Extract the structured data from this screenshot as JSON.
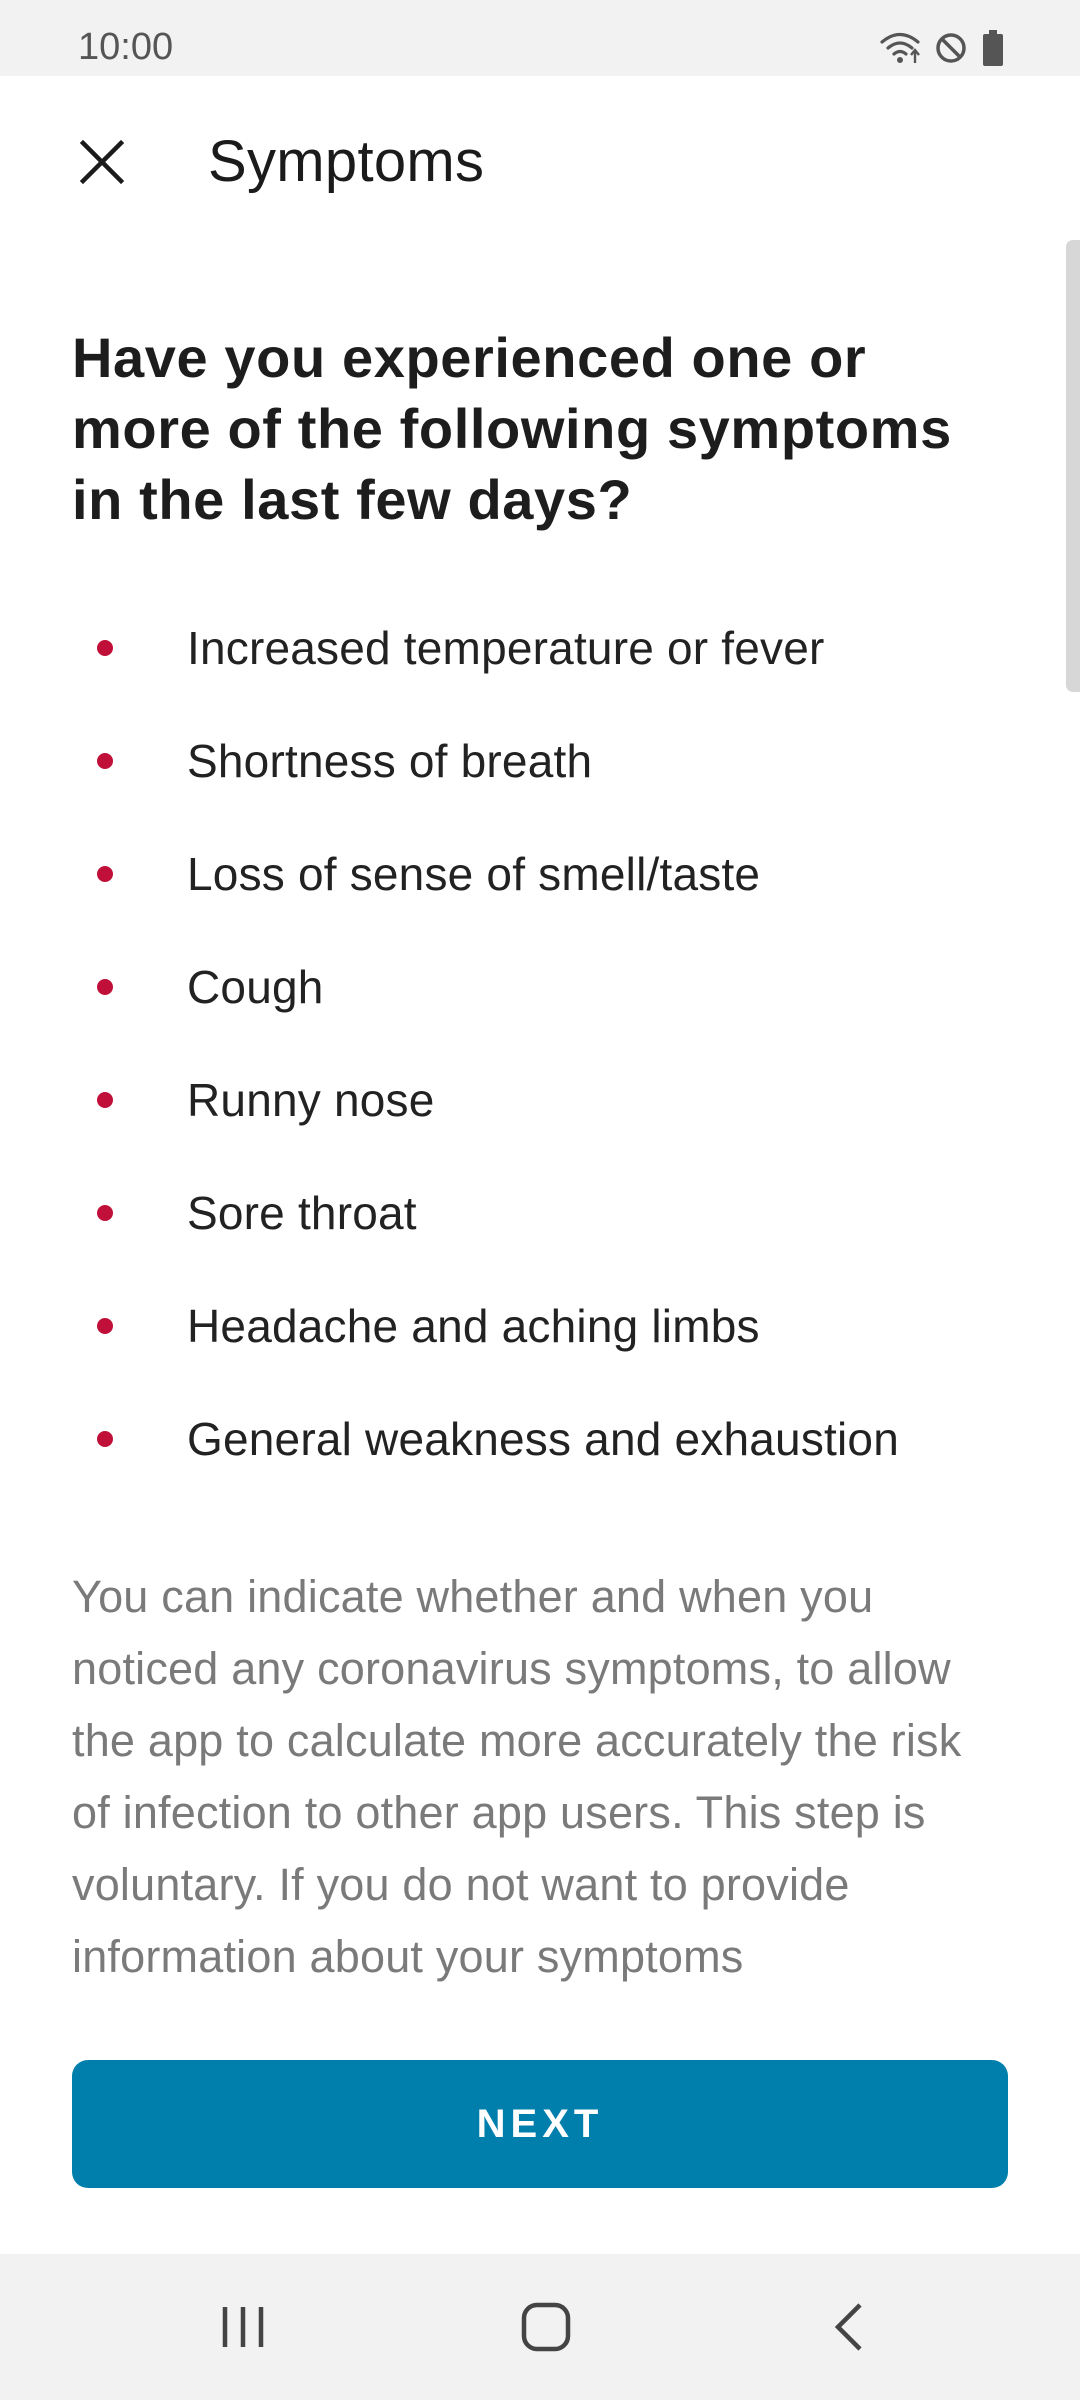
{
  "status_bar": {
    "time": "10:00",
    "icons": [
      "wifi-icon",
      "do-not-disturb-icon",
      "battery-icon"
    ]
  },
  "header": {
    "title": "Symptoms",
    "close_icon": "close-icon"
  },
  "main": {
    "question": "Have you experienced one or more of the following symptoms in the last few days?",
    "symptoms": [
      "Increased temperature or fever",
      "Shortness of breath",
      "Loss of sense of smell/taste",
      "Cough",
      "Runny nose",
      "Sore throat",
      "Headache and aching limbs",
      "General weakness and exhaustion"
    ],
    "info_text": "You can indicate whether and when you noticed any coronavirus symptoms, to allow the app to calculate more accurately the risk of infection to other app users. This step is voluntary. If you do not want to provide information about your symptoms"
  },
  "footer": {
    "next_label": "NEXT"
  },
  "nav_bar": {
    "icons": [
      "recents-icon",
      "home-icon",
      "back-icon"
    ]
  },
  "colors": {
    "accent": "#007fad",
    "bullet": "#c0103a",
    "info_text": "#7a7a7a"
  }
}
